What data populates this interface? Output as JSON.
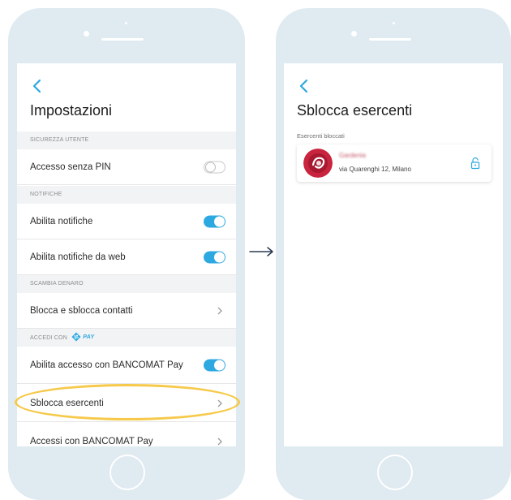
{
  "left_screen": {
    "title": "Impostazioni",
    "sections": {
      "security": "SICUREZZA UTENTE",
      "notifications": "NOTIFICHE",
      "exchange": "SCAMBIA DENARO",
      "access": "ACCEDI CON",
      "access_badge": "PAY"
    },
    "rows": {
      "pinless_access": "Accesso senza PIN",
      "enable_notifications": "Abilita notifiche",
      "enable_web_notifications": "Abilita notifiche da web",
      "block_contacts": "Blocca e sblocca contatti",
      "enable_bancomat_access": "Abilita accesso con BANCOMAT Pay",
      "unlock_merchants": "Sblocca esercenti",
      "bancomat_accesses": "Accessi con BANCOMAT Pay"
    },
    "toggles": {
      "pinless_access": false,
      "enable_notifications": true,
      "enable_web_notifications": true,
      "enable_bancomat_access": true
    }
  },
  "right_screen": {
    "title": "Sblocca esercenti",
    "subheader": "Esercenti bloccati",
    "merchant": {
      "name": "Gardenia",
      "address": "via Quarenghi 12, Milano"
    }
  },
  "colors": {
    "accent": "#2ea8e0",
    "highlight": "#f6c94a",
    "phone": "#dfeaf1"
  }
}
